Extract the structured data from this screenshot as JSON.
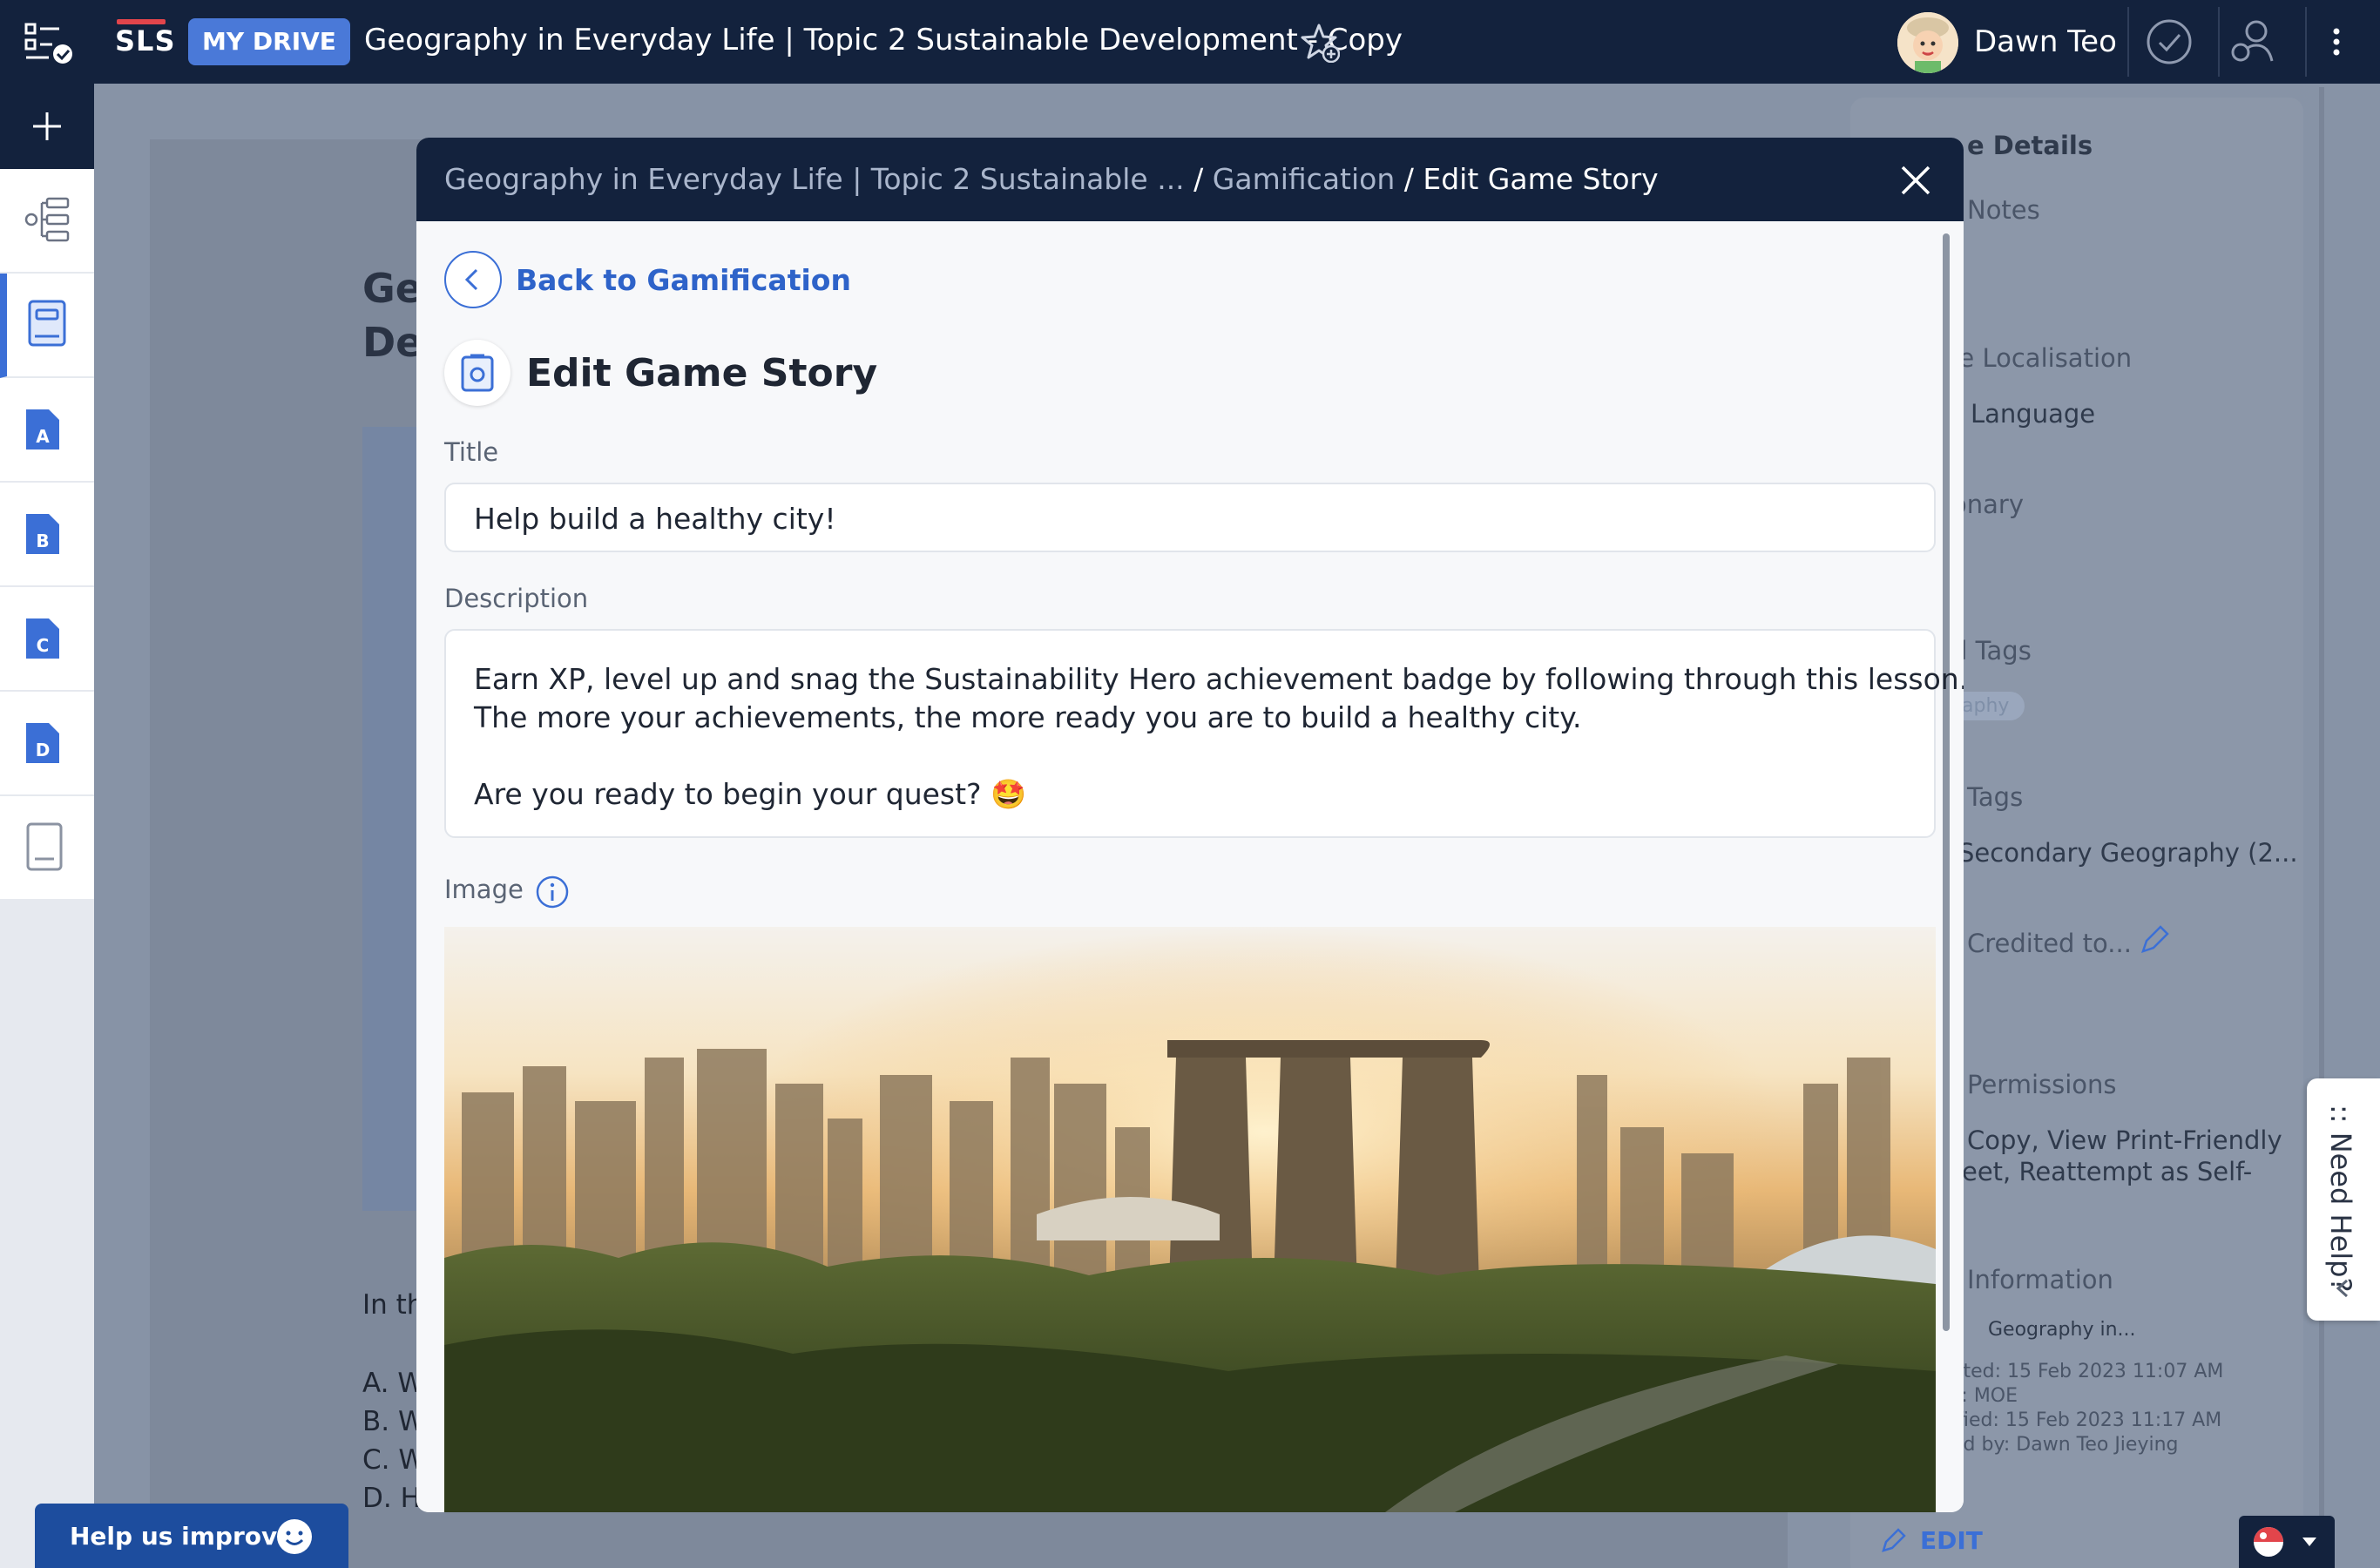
{
  "topbar": {
    "logo": "SLS",
    "drive_badge": "MY DRIVE",
    "title": "Geography in Everyday Life | Topic 2 Sustainable Development - Copy",
    "user_name": "Dawn Teo"
  },
  "background": {
    "heading_line1": "Ge",
    "heading_line2": "De",
    "body_line1": "In th",
    "body_a": "A. W",
    "body_b": "B. W",
    "body_c": "C. W",
    "body_d": "D. H",
    "right": {
      "section_title": "e Details",
      "notes": "Notes",
      "localisation": "ge Localisation",
      "language": "Language",
      "dictionary": "onary",
      "tags": "d Tags",
      "tag_pill": "aphy",
      "tags2": "Tags",
      "secondary_geo": "Secondary Geography (2...",
      "credited": "Credited to...",
      "permissions": "Permissions",
      "perm_line1": "Copy, View Print-Friendly",
      "perm_line2": "eet, Reattempt as Self-",
      "information": "Information",
      "info_link": "Geography in...",
      "created": "ated: 15 Feb 2023 11:07 AM",
      "by": "y: MOE",
      "modified": "ified: 15 Feb 2023 11:17 AM",
      "modified_by": "ed by: Dawn Teo Jieying",
      "edit": "EDIT"
    }
  },
  "modal": {
    "breadcrumb": {
      "root": "Geography in Everyday Life | Topic 2 Sustainable ...",
      "sep1": " / ",
      "parent": "Gamification",
      "sep2": " / ",
      "current": "Edit Game Story"
    },
    "back_label": "Back to Gamification",
    "page_title": "Edit Game Story",
    "title_label": "Title",
    "title_value": "Help build a healthy city!",
    "description_label": "Description",
    "description_line1": "Earn XP, level up and snag the Sustainability Hero achievement badge by following through this lesson.",
    "description_line2": "The more your achievements, the more ready you are to build a healthy city.",
    "description_line3": "Are you ready to begin your quest? 🤩",
    "image_label": "Image"
  },
  "floating": {
    "help_improve": "Help us improve",
    "need_help": ":: Need Help?"
  },
  "colors": {
    "navy": "#13223d",
    "accent_blue": "#3b6fd6",
    "drive_badge": "#4a79d8"
  }
}
